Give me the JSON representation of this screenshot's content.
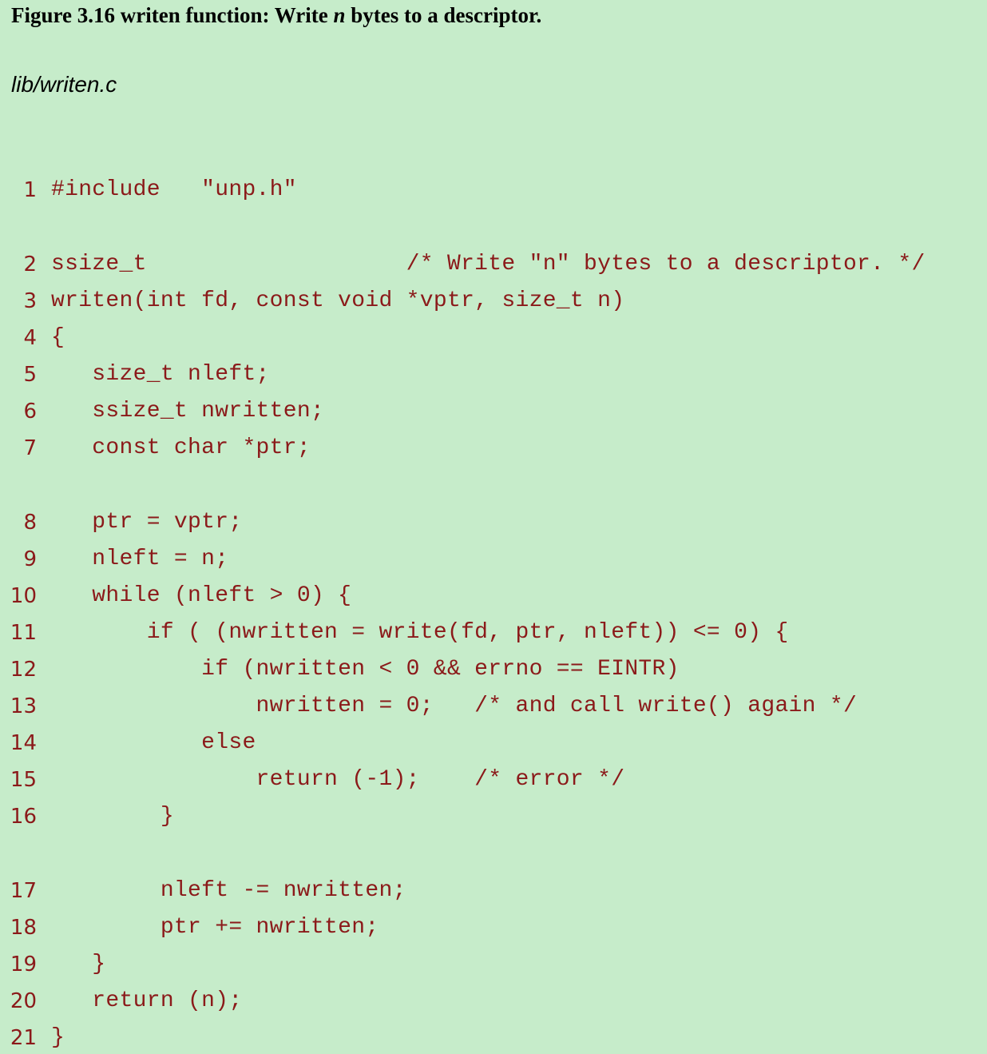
{
  "figure": {
    "title_prefix": "Figure 3.16 writen function: Write ",
    "title_var": "n",
    "title_suffix": " bytes to a descriptor."
  },
  "file": "lib/writen.c",
  "code_lines": [
    {
      "num": "1",
      "text": "#include   \"unp.h\""
    },
    {
      "num": "2",
      "text": "ssize_t                   /* Write \"n\" bytes to a descriptor. */"
    },
    {
      "num": "3",
      "text": "writen(int fd, const void *vptr, size_t n)"
    },
    {
      "num": "4",
      "text": "{"
    },
    {
      "num": "5",
      "text": "   size_t nleft;"
    },
    {
      "num": "6",
      "text": "   ssize_t nwritten;"
    },
    {
      "num": "7",
      "text": "   const char *ptr;"
    },
    {
      "num": "8",
      "text": "   ptr = vptr;"
    },
    {
      "num": "9",
      "text": "   nleft = n;"
    },
    {
      "num": "10",
      "text": "   while (nleft > 0) {"
    },
    {
      "num": "11",
      "text": "       if ( (nwritten = write(fd, ptr, nleft)) <= 0) {"
    },
    {
      "num": "12",
      "text": "           if (nwritten < 0 && errno == EINTR)"
    },
    {
      "num": "13",
      "text": "               nwritten = 0;   /* and call write() again */"
    },
    {
      "num": "14",
      "text": "           else"
    },
    {
      "num": "15",
      "text": "               return (-1);    /* error */"
    },
    {
      "num": "16",
      "text": "        }"
    },
    {
      "num": "17",
      "text": "        nleft -= nwritten;"
    },
    {
      "num": "18",
      "text": "        ptr += nwritten;"
    },
    {
      "num": "19",
      "text": "   }"
    },
    {
      "num": "20",
      "text": "   return (n);"
    },
    {
      "num": "21",
      "text": "}"
    }
  ]
}
